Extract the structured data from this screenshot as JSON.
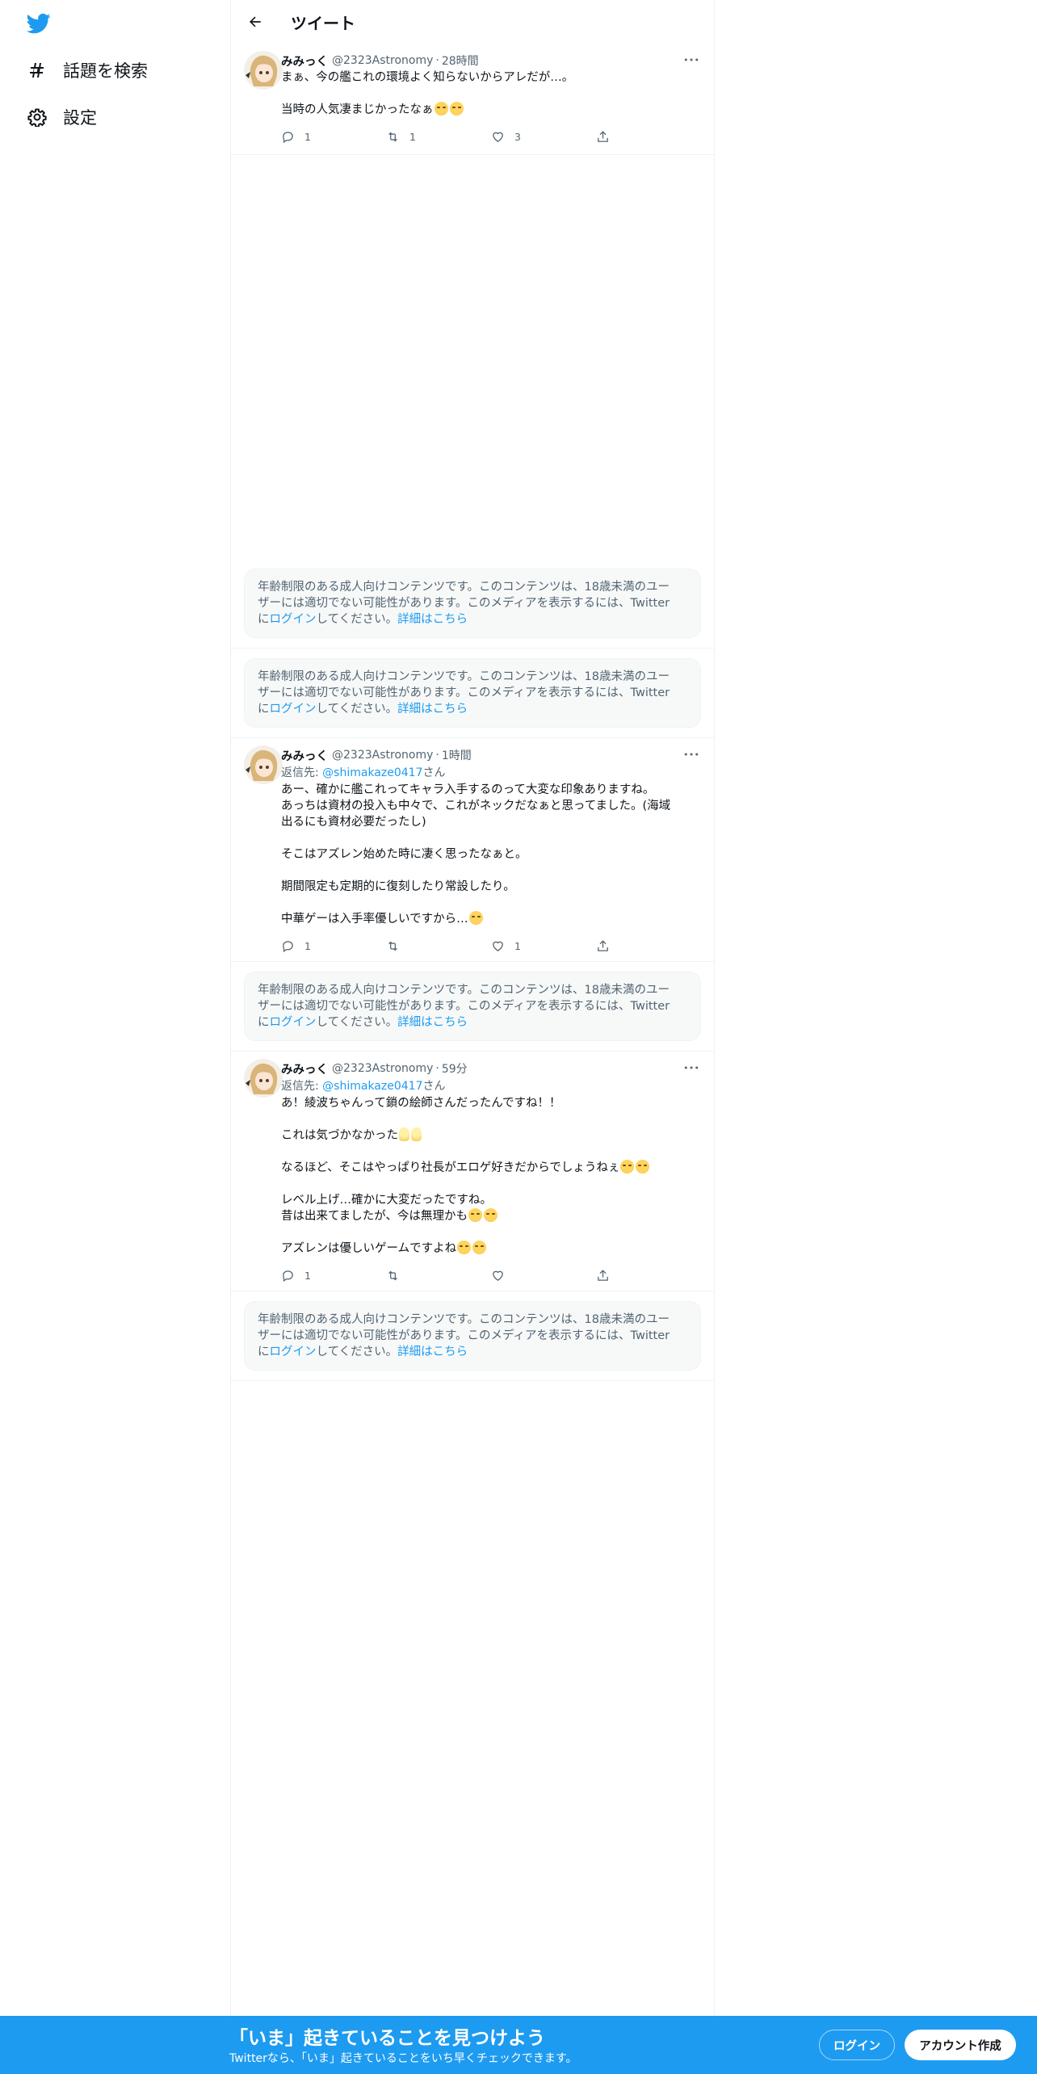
{
  "colors": {
    "brand": "#1d9bf0",
    "text": "#0f1419",
    "muted": "#536471",
    "border": "#eff3f4"
  },
  "sidebar": {
    "logo_icon": "twitter-bird-icon",
    "items": [
      {
        "icon": "hashtag-icon",
        "label": "話題を検索"
      },
      {
        "icon": "gear-icon",
        "label": "設定"
      }
    ]
  },
  "header": {
    "title": "ツイート",
    "back_icon": "arrow-left-icon"
  },
  "tweets": [
    {
      "name": "みみっく",
      "handle": "@2323Astronomy",
      "dot": "·",
      "time": "28時間",
      "reply_prefix": "",
      "reply_mention": "",
      "reply_suffix": "",
      "lines": [
        "まぁ、今の艦これの環境よく知らないからアレだが…。",
        "",
        "当時の人気凄まじかったなぁ"
      ],
      "emojis": [
        "relieved-face",
        "relieved-face"
      ],
      "actions": {
        "reply": "1",
        "retweet": "1",
        "like": "3"
      }
    },
    {
      "name": "みみっく",
      "handle": "@2323Astronomy",
      "dot": "·",
      "time": "1時間",
      "reply_prefix": "返信先: ",
      "reply_mention": "@shimakaze0417",
      "reply_suffix": "さん",
      "lines": [
        "あー、確かに艦これってキャラ入手するのって大変な印象ありますね。",
        "あっちは資材の投入も中々で、これがネックだなぁと思ってました。(海域",
        "出るにも資材必要だったし)",
        "",
        "そこはアズレン始めた時に凄く思ったなぁと。",
        "",
        "期間限定も定期的に復刻したり常設したり。",
        "",
        "中華ゲーは入手率優しいですから…"
      ],
      "actions": {
        "reply": "1",
        "retweet": "",
        "like": "1"
      }
    },
    {
      "name": "みみっく",
      "handle": "@2323Astronomy",
      "dot": "·",
      "time": "59分",
      "reply_prefix": "返信先: ",
      "reply_mention": "@shimakaze0417",
      "reply_suffix": "さん",
      "lines": [
        "あ！綾波ちゃんって鎖の絵師さんだったんですね！！",
        "",
        "これは気づかなかった",
        "",
        "なるほど、そこはやっぱり社長がエロゲ好きだからでしょうねぇ",
        "",
        "レベル上げ…確かに大変だったですね。",
        "昔は出来てましたが、今は無理かも",
        "",
        "アズレンは優しいゲームですよね"
      ],
      "actions": {
        "reply": "1",
        "retweet": "",
        "like": ""
      }
    }
  ],
  "media_notice": {
    "part1": "年齢制限のある成人向けコンテンツです。このコンテンツは、18歳未満のユー",
    "part2": "ザーには適切でない可能性があります。このメディアを表示するには、Twitter",
    "part3_pre": "に",
    "login_link": "ログイン",
    "part3_mid": "してください。",
    "learn_more": "詳細はこちら"
  },
  "banner": {
    "title": "「いま」起きていることを見つけよう",
    "subtitle": "Twitterなら、「いま」起きていることをいち早くチェックできます。",
    "login": "ログイン",
    "signup": "アカウント作成"
  }
}
